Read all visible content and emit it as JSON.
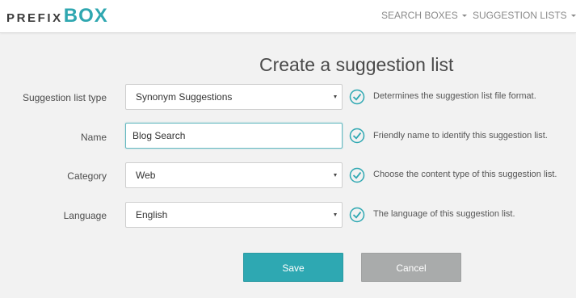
{
  "brand": {
    "prefix": "PREFIX",
    "box": "BOX"
  },
  "nav": {
    "search_boxes": "SEARCH BOXES",
    "suggestion_lists": "SUGGESTION LISTS"
  },
  "page": {
    "title": "Create a suggestion list"
  },
  "form": {
    "type": {
      "label": "Suggestion list type",
      "value": "Synonym Suggestions",
      "help": "Determines the suggestion list file format."
    },
    "name": {
      "label": "Name",
      "value": "Blog Search",
      "help": "Friendly name to identify this suggestion list."
    },
    "category": {
      "label": "Category",
      "value": "Web",
      "help": "Choose the content type of this suggestion list."
    },
    "language": {
      "label": "Language",
      "value": "English",
      "help": "The language of this suggestion list."
    }
  },
  "actions": {
    "save": "Save",
    "cancel": "Cancel"
  },
  "colors": {
    "accent": "#2ea8b2",
    "cancel": "#a9abab",
    "background": "#f2f2f2"
  }
}
